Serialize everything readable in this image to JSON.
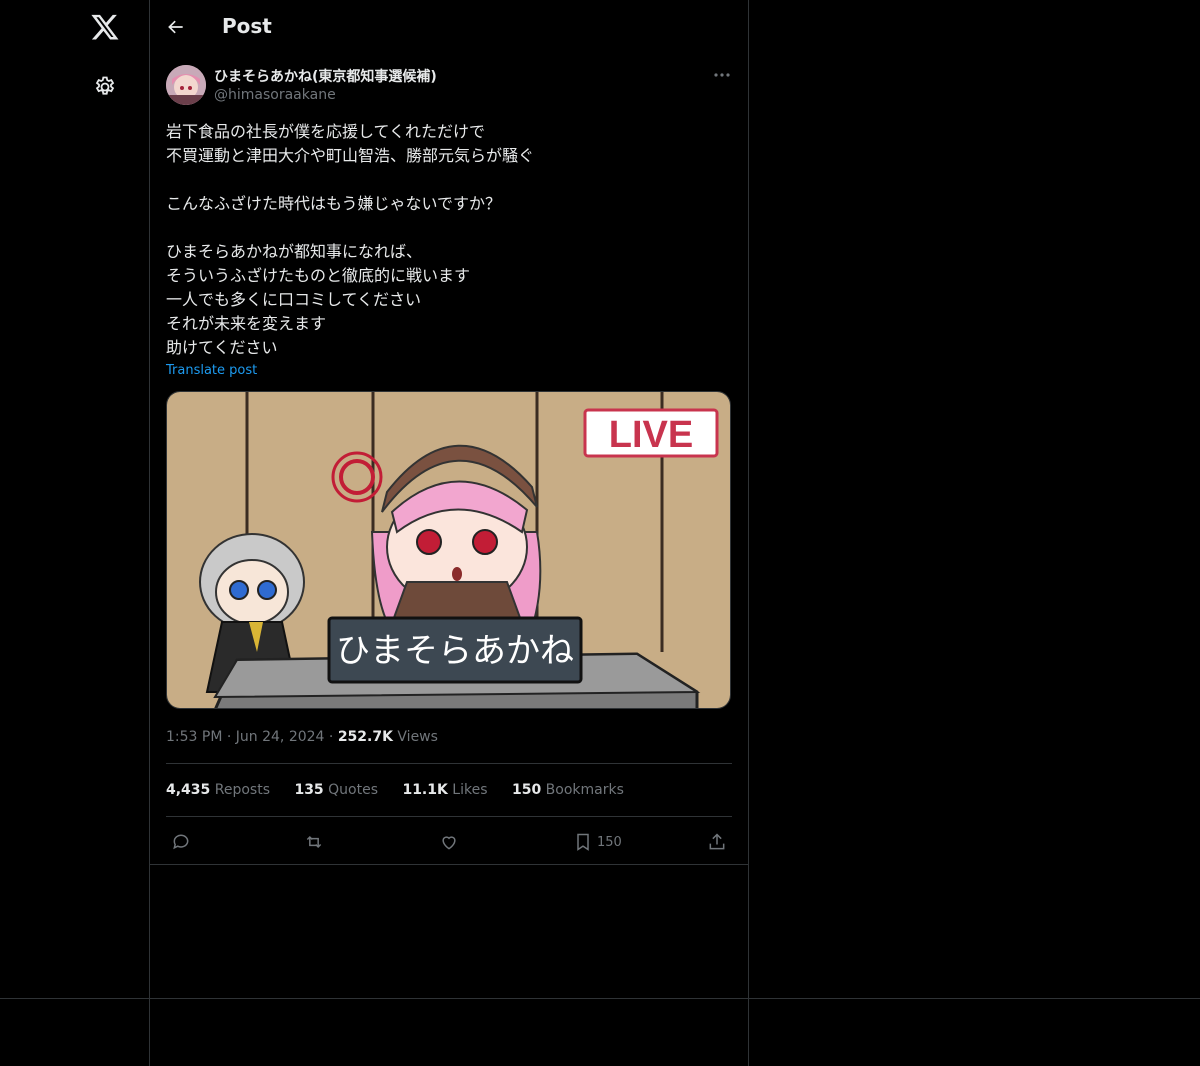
{
  "sidebar": {
    "logo_icon": "x-logo-icon",
    "settings_icon": "gear-icon"
  },
  "header": {
    "title": "Post",
    "back_icon": "arrow-left-icon"
  },
  "post": {
    "display_name": "ひまそらあかね(東京都知事選候補)",
    "handle": "@himasoraakane",
    "lines": [
      "岩下食品の社長が僕を応援してくれただけで",
      "不買運動と津田大介や町山智浩、勝部元気らが騒ぐ",
      "",
      "こんなふざけた時代はもう嫌じゃないですか？",
      "",
      "ひまそらあかねが都知事になれば、",
      "そういうふざけたものと徹底的に戦います",
      "一人でも多くに口コミしてください",
      "それが未来を変えます",
      "助けてください"
    ],
    "translate_label": "Translate post",
    "media": {
      "live_badge": "LIVE",
      "nameplate": "ひまそらあかね"
    },
    "time": "1:53 PM",
    "date": "Jun 24, 2024",
    "views_count": "252.7K",
    "views_label": "Views",
    "stats": {
      "reposts_count": "4,435",
      "reposts_label": "Reposts",
      "quotes_count": "135",
      "quotes_label": "Quotes",
      "likes_count": "11.1K",
      "likes_label": "Likes",
      "bookmarks_count": "150",
      "bookmarks_label": "Bookmarks"
    },
    "actions": {
      "bookmark_count": "150"
    }
  },
  "colors": {
    "background": "#000000",
    "border": "#2f3336",
    "text": "#e7e9ea",
    "muted": "#71767b",
    "link": "#1d9bf0"
  }
}
